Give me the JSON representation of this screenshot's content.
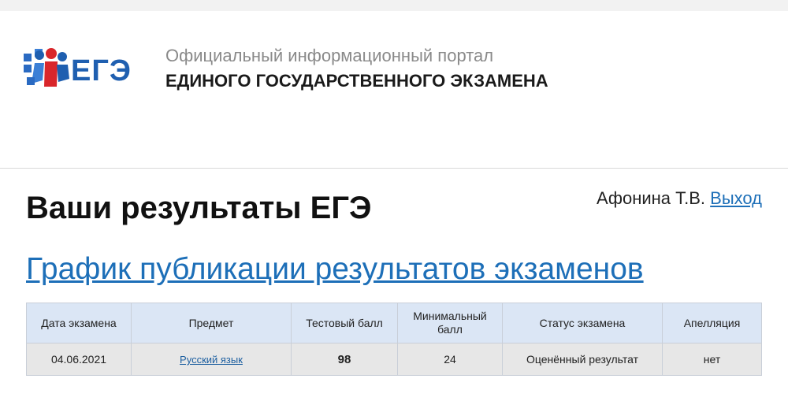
{
  "header": {
    "logo_text": "ЕГЭ",
    "portal_subtitle": "Официальный информационный портал",
    "portal_title": "ЕДИНОГО ГОСУДАРСТВЕННОГО ЭКЗАМЕНА"
  },
  "page": {
    "title": "Ваши результаты ЕГЭ",
    "user_name": "Афонина Т.В.",
    "logout_label": "Выход",
    "schedule_link": "График публикации результатов экзаменов"
  },
  "colors": {
    "link": "#1d6fb8",
    "score": "#1e8f1e",
    "table_header_bg": "#dbe6f5",
    "table_row_bg": "#e7e7e7",
    "logo_blue": "#1f5fb0",
    "logo_red": "#d9262b"
  },
  "table": {
    "columns": [
      "Дата экзамена",
      "Предмет",
      "Тестовый балл",
      "Минимальный балл",
      "Статус экзамена",
      "Апелляция"
    ],
    "rows": [
      {
        "date": "04.06.2021",
        "subject": "Русский язык",
        "score": "98",
        "min_score": "24",
        "status": "Оценённый результат",
        "appeal": "нет"
      }
    ]
  }
}
